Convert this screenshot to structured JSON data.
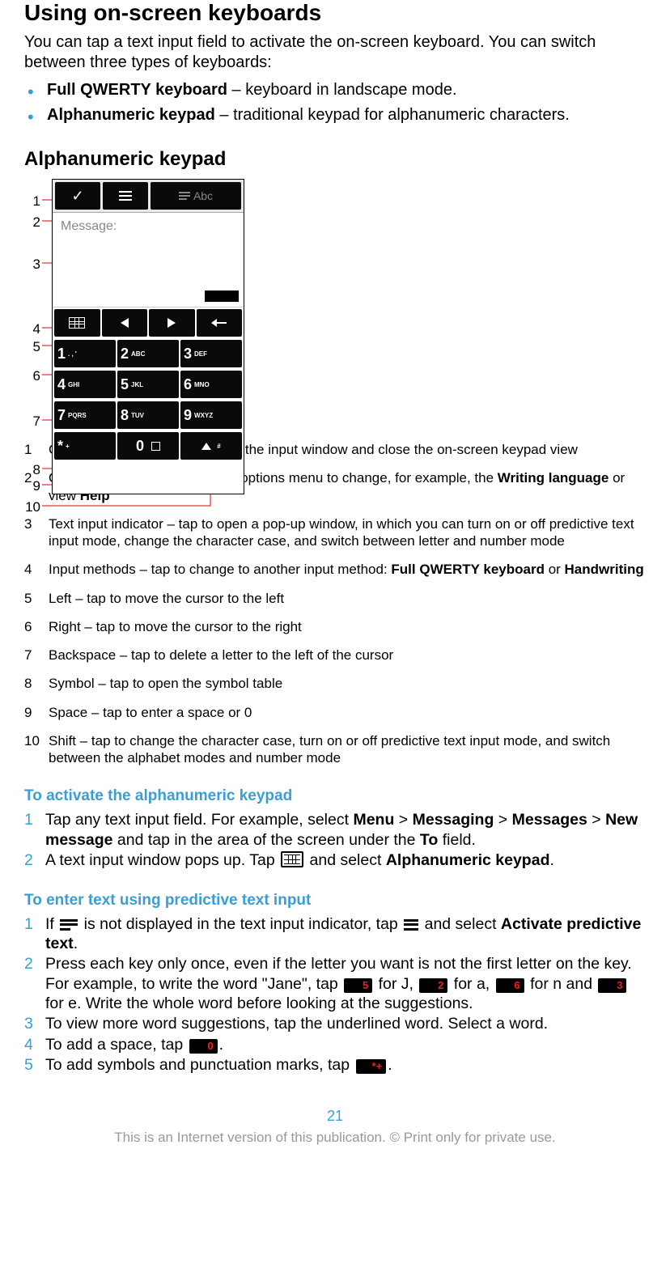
{
  "title": "Using on-screen keyboards",
  "intro": "You can tap a text input field to activate the on-screen keyboard. You can switch between three types of keyboards:",
  "bullets": [
    {
      "bold": "Full QWERTY keyboard",
      "rest": " – keyboard in landscape mode."
    },
    {
      "bold": "Alphanumeric keypad",
      "rest": " – traditional keypad for alphanumeric characters."
    }
  ],
  "section_keypad_title": "Alphanumeric keypad",
  "keypad_ui": {
    "message_placeholder": "Message:",
    "abc_label": "Abc",
    "keys": [
      [
        {
          "d": "1",
          "l": ". , '"
        },
        {
          "d": "2",
          "l": "ABC"
        },
        {
          "d": "3",
          "l": "DEF"
        }
      ],
      [
        {
          "d": "4",
          "l": "GHI"
        },
        {
          "d": "5",
          "l": "JKL"
        },
        {
          "d": "6",
          "l": "MNO"
        }
      ],
      [
        {
          "d": "7",
          "l": "PQRS"
        },
        {
          "d": "8",
          "l": "TUV"
        },
        {
          "d": "9",
          "l": "WXYZ"
        }
      ]
    ],
    "bottom": {
      "star": "*",
      "plus": "+",
      "zero": "0",
      "hash": "#"
    }
  },
  "side_labels": [
    "1",
    "2",
    "3",
    "4",
    "5",
    "6",
    "7",
    "8",
    "9",
    "10"
  ],
  "callouts": [
    {
      "n": "1",
      "html": "Close – tap to accept the text in the input window and close the on-screen keypad view"
    },
    {
      "n": "2",
      "html": "Options – tap to open the input options menu to change, for example, the <b>Writing language</b> or view <b>Help</b>"
    },
    {
      "n": "3",
      "html": "Text input indicator – tap to open a pop-up window, in which you can turn on or off predictive text input mode, change the character case, and switch between letter and number mode"
    },
    {
      "n": "4",
      "html": "Input methods – tap to change to another input method: <b>Full QWERTY keyboard</b> or <b>Handwriting</b>"
    },
    {
      "n": "5",
      "html": "Left – tap to move the cursor to the left"
    },
    {
      "n": "6",
      "html": "Right – tap to move the cursor to the right"
    },
    {
      "n": "7",
      "html": "Backspace – tap to delete a letter to the left of the cursor"
    },
    {
      "n": "8",
      "html": "Symbol – tap to open the symbol table"
    },
    {
      "n": "9",
      "html": "Space – tap to enter a space or 0"
    },
    {
      "n": "10",
      "html": "Shift – tap to change the character case, turn on or off predictive text input mode, and switch between the alphabet modes and number mode"
    }
  ],
  "activate_title": "To activate the alphanumeric keypad",
  "activate_steps": [
    {
      "n": "1",
      "html": "Tap any text input field. For example, select <b>Menu</b> > <b>Messaging</b> > <b>Messages</b> > <b>New message</b> and tap in the area of the screen under the <b>To</b> field."
    },
    {
      "n": "2",
      "html": "A text input window pops up. Tap {kbd} and select <b>Alphanumeric keypad</b>."
    }
  ],
  "predictive_title": "To enter text using predictive text input",
  "predictive_steps": [
    {
      "n": "1",
      "html": "If {lines3} is not displayed in the text input indicator, tap {opt} and select <b>Activate predictive text</b>."
    },
    {
      "n": "2",
      "html": "Press each key only once, even if the letter you want is not the first letter on the key. For example, to write the word \"Jane\", tap {k5} for J, {k2} for a, {k6} for n and {k3} for e. Write the whole word before looking at the suggestions."
    },
    {
      "n": "3",
      "html": "To view more word suggestions, tap the underlined word. Select a word."
    },
    {
      "n": "4",
      "html": "To add a space, tap {k0}."
    },
    {
      "n": "5",
      "html": "To add symbols and punctuation marks, tap {kstar}."
    }
  ],
  "key_chips": {
    "k5": "5",
    "k2": "2",
    "k6": "6",
    "k3": "3",
    "k0": "0",
    "kstar": "*+"
  },
  "page_number": "21",
  "footer": "This is an Internet version of this publication. © Print only for private use."
}
